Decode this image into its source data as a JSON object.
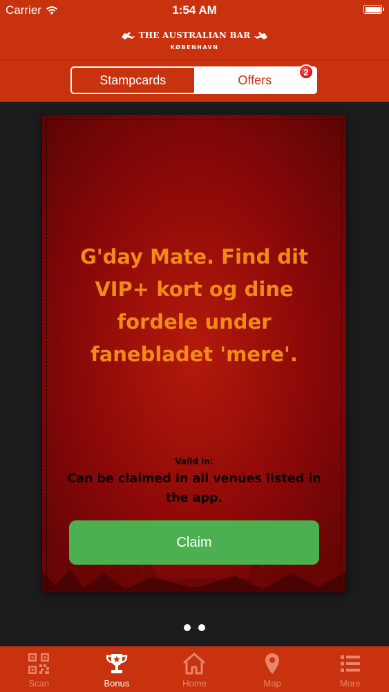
{
  "status_bar": {
    "carrier": "Carrier",
    "time": "1:54 AM",
    "battery_level": 1.0
  },
  "header": {
    "logo_line1": "THE AUSTRALIAN BAR",
    "logo_line2": "KØBENHAVN"
  },
  "segments": {
    "left_label": "Stampcards",
    "right_label": "Offers",
    "selected": "Offers",
    "badge_count": "2"
  },
  "offer_card": {
    "headline": "G'day Mate. Find dit VIP+ kort og dine fordele under fanebladet 'mere'.",
    "valid_label": "Valid in:",
    "valid_text": "Can be claimed in all venues listed in the app.",
    "claim_label": "Claim"
  },
  "pagination": {
    "pages": 2
  },
  "tabbar": {
    "items": [
      {
        "label": "Scan",
        "icon": "qr-code-icon"
      },
      {
        "label": "Bonus",
        "icon": "trophy-icon"
      },
      {
        "label": "Home",
        "icon": "home-icon"
      },
      {
        "label": "Map",
        "icon": "map-pin-icon"
      },
      {
        "label": "More",
        "icon": "list-icon"
      }
    ],
    "active": "Bonus"
  },
  "colors": {
    "brand_red": "#c8320e",
    "card_red": "#8a0808",
    "headline_orange": "#f08a1a",
    "claim_green": "#4caf50",
    "tab_inactive": "#e8866c",
    "badge_red": "#d10f0f"
  }
}
